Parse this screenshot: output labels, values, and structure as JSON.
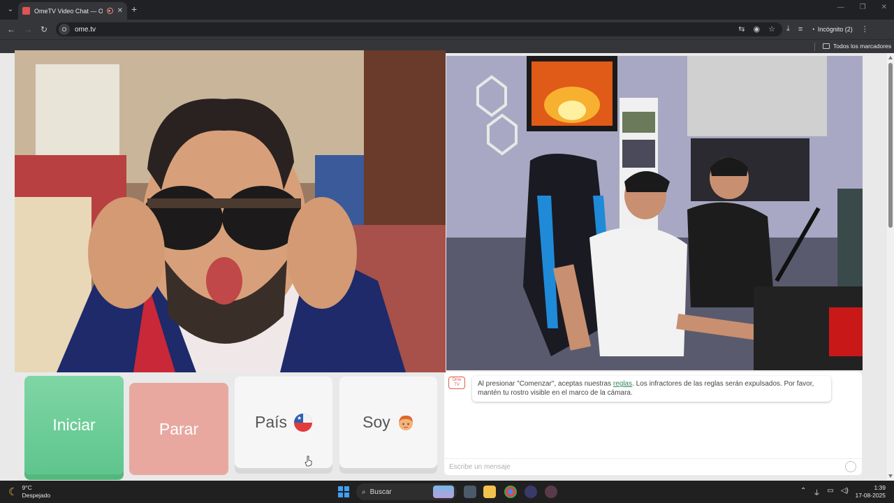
{
  "browser": {
    "tab_title": "OmeTV Video Chat — Ome",
    "url": "ome.tv",
    "site_badge": "O",
    "incognito_label": "Incógnito (2)",
    "bookmarks_all_label": "Todos los marcadores"
  },
  "controls": {
    "start_label": "Iniciar",
    "stop_label": "Parar",
    "country_label": "País",
    "gender_label": "Soy"
  },
  "chat": {
    "logo_text": "Ome TV",
    "notice_before": "Al presionar \"Comenzar\", aceptas nuestras ",
    "notice_link": "reglas",
    "notice_after": ". Los infractores de las reglas serán expulsados. Por favor, mantén tu rostro visible en el marco de la cámara.",
    "input_placeholder": "Escribe un mensaje"
  },
  "taskbar": {
    "temperature": "9°C",
    "weather": "Despejado",
    "search_label": "Buscar",
    "time": "1:39",
    "date": "17-08-2025"
  },
  "colors": {
    "start_green": "#6fcf97",
    "stop_red": "#e8a8a0",
    "brand_red": "#e25b4a"
  }
}
